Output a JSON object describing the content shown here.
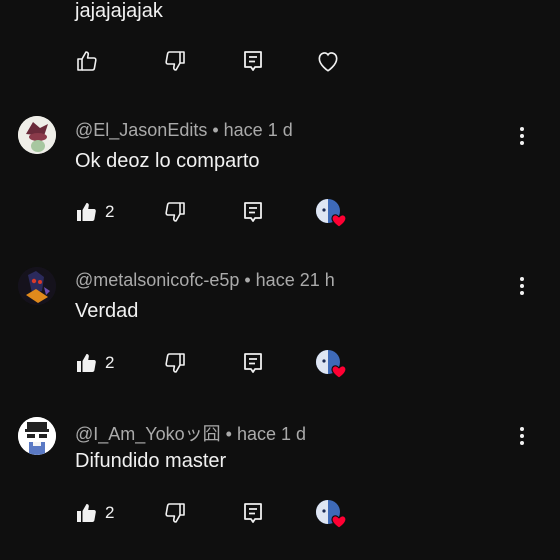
{
  "top_comment": {
    "text": "jajajajajak"
  },
  "comments": [
    {
      "handle": "@El_JasonEdits",
      "time": "hace 1 d",
      "text": "Ok deoz lo comparto",
      "likes": "2"
    },
    {
      "handle": "@metalsonicofc-e5p",
      "time": "hace 21 h",
      "text": "Verdad",
      "likes": "2"
    },
    {
      "handle": "@I_Am_Yokoッ囧",
      "time": "hace 1 d",
      "text": "Difundido master",
      "likes": "2"
    }
  ],
  "separator": " • ",
  "colors": {
    "background": "#0f0f0f",
    "text": "#f1f1f1",
    "meta": "#aaaaaa",
    "heart": "#ff0033",
    "creator_avatar": "#3e6ab8"
  },
  "icons": [
    "thumbs-up-icon",
    "thumbs-down-icon",
    "reply-icon",
    "heart-icon",
    "creator-heart-icon",
    "more-options-icon"
  ]
}
